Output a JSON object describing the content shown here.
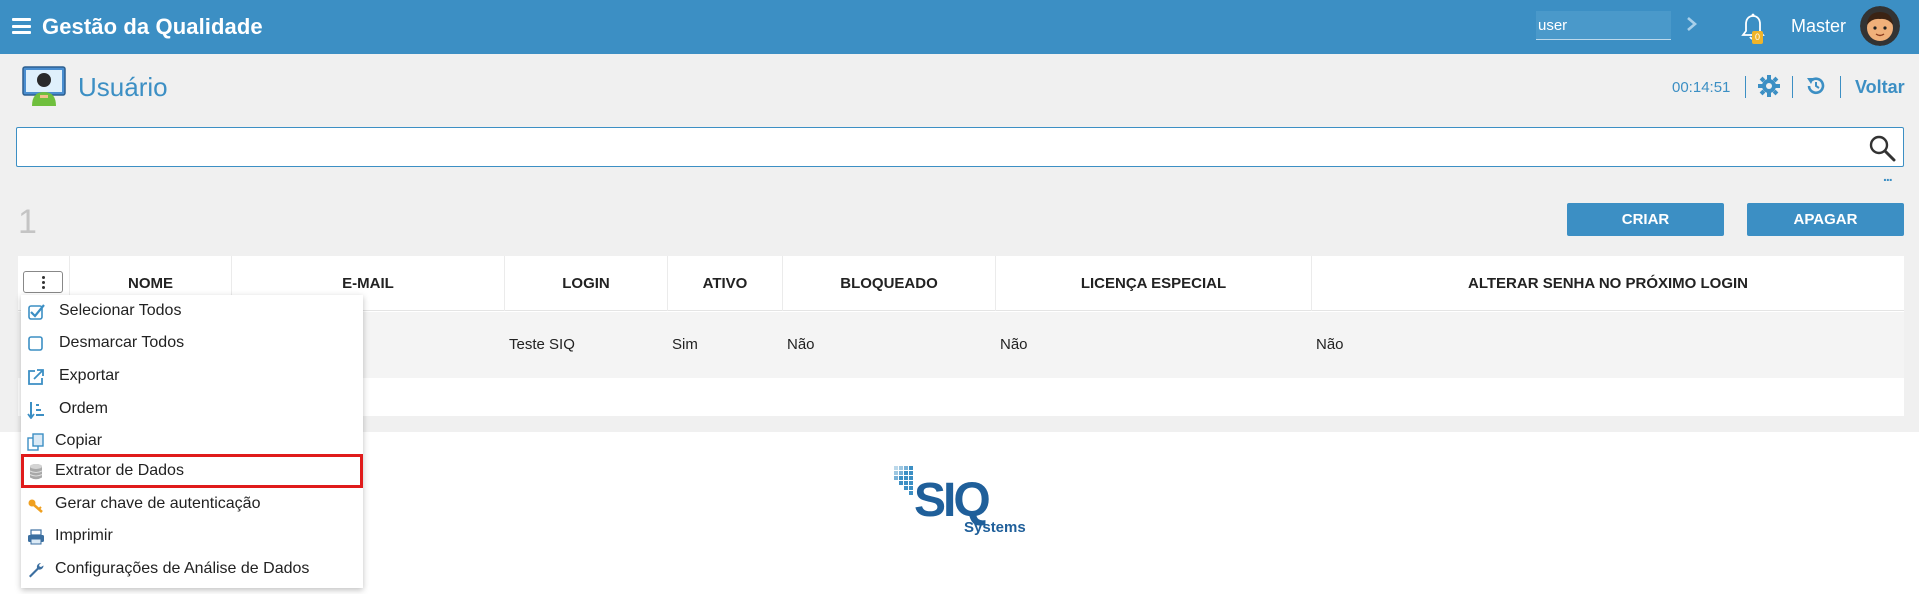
{
  "topbar": {
    "title": "Gestão da Qualidade",
    "user_input_value": "user",
    "notification_count": "0",
    "user_name": "Master"
  },
  "header": {
    "title": "Usuário",
    "timer": "00:14:51",
    "back_label": "Voltar"
  },
  "search": {
    "value": "",
    "more_label": "..."
  },
  "toolbar": {
    "count": "1",
    "create_label": "CRIAR",
    "delete_label": "APAGAR"
  },
  "table": {
    "columns": [
      "NOME",
      "E-MAIL",
      "LOGIN",
      "ATIVO",
      "BLOQUEADO",
      "LICENÇA ESPECIAL",
      "ALTERAR SENHA NO PRÓXIMO LOGIN"
    ],
    "rows": [
      {
        "login": "Teste SIQ",
        "ativo": "Sim",
        "bloqueado": "Não",
        "licenca": "Não",
        "alterar_senha": "Não"
      }
    ]
  },
  "menu": {
    "items": [
      {
        "label": "Selecionar Todos",
        "icon": "checkbox-checked-icon"
      },
      {
        "label": "Desmarcar Todos",
        "icon": "checkbox-empty-icon"
      },
      {
        "label": "Exportar",
        "icon": "export-icon"
      },
      {
        "label": "Ordem",
        "icon": "sort-icon"
      },
      {
        "label": "Copiar",
        "icon": "copy-icon"
      },
      {
        "label": "Extrator de Dados",
        "icon": "database-icon"
      },
      {
        "label": "Gerar chave de autenticação",
        "icon": "key-icon"
      },
      {
        "label": "Imprimir",
        "icon": "printer-icon"
      },
      {
        "label": "Configurações de Análise de Dados",
        "icon": "wrench-icon"
      }
    ]
  },
  "logo": {
    "brand": "SIQ",
    "sub": "Systems"
  },
  "colors": {
    "primary": "#3c8fc4",
    "highlight": "#e01b1b"
  }
}
